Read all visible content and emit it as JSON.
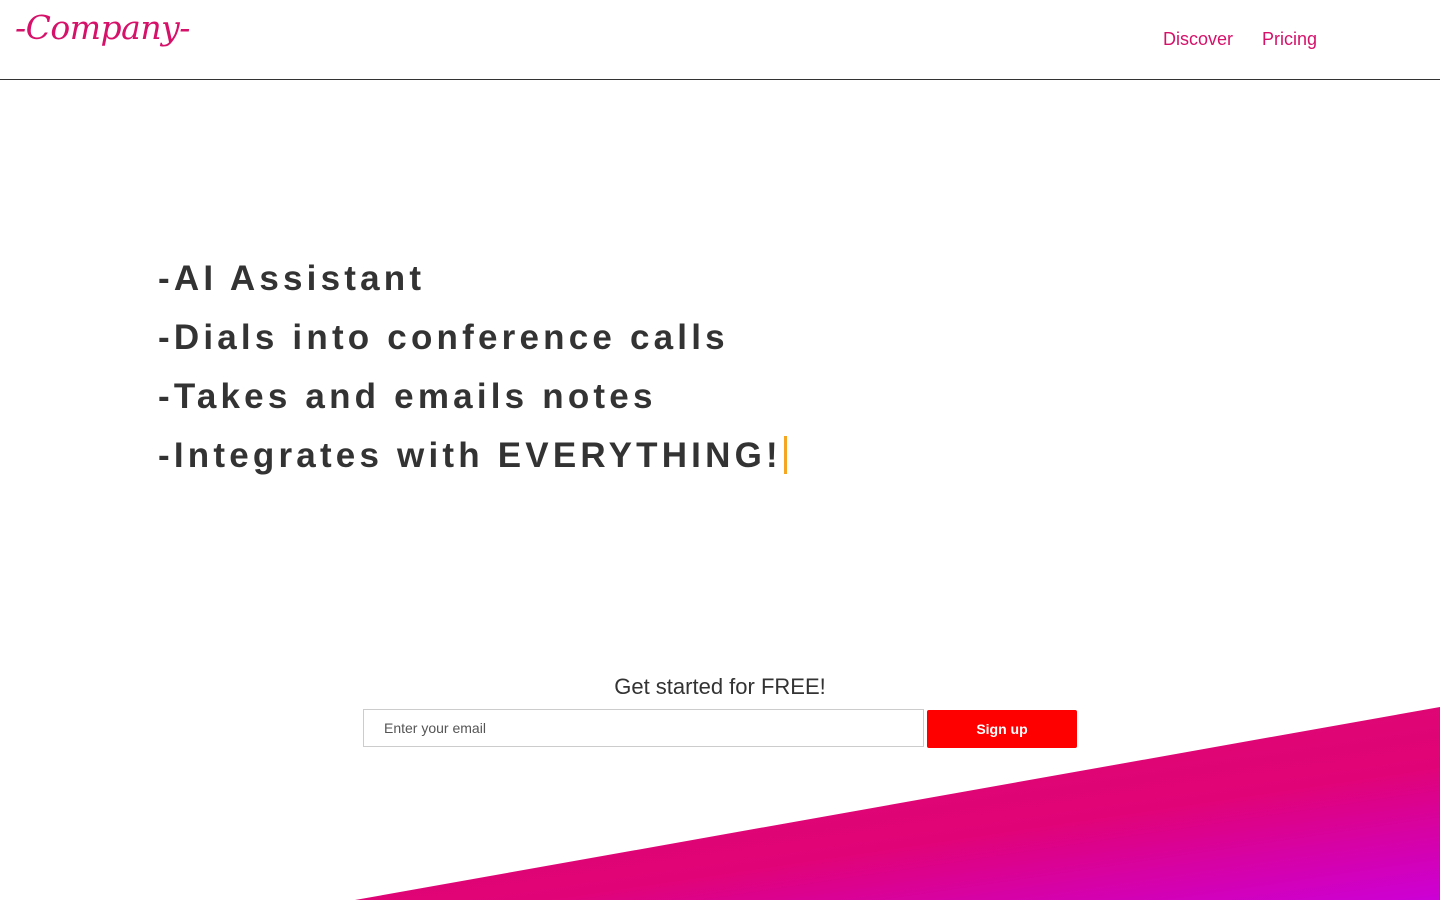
{
  "header": {
    "logo_text": "-Company-",
    "nav": [
      {
        "label": "Discover"
      },
      {
        "label": "Pricing"
      }
    ]
  },
  "hero": {
    "lines": [
      "-AI Assistant",
      "-Dials into conference calls",
      "-Takes and emails notes",
      "-Integrates with EVERYTHING!"
    ]
  },
  "signup": {
    "heading": "Get started for FREE!",
    "email_placeholder": "Enter your email",
    "button_label": "Sign up"
  },
  "colors": {
    "brand": "#d6116a",
    "button": "#ff0000",
    "caret": "#f5a623",
    "gradient_start": "#dc0a6e",
    "gradient_end": "#cc00d6"
  }
}
